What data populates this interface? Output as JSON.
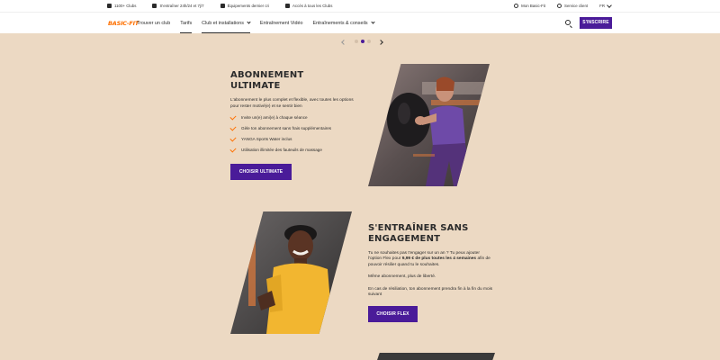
{
  "topbar": {
    "perks": [
      "1100+ Clubs",
      "S'entraîner 24h/24 et 7j/7",
      "Équipements dernier cri",
      "Accès à tous les Clubs"
    ],
    "my_account": "Mon Basic-Fit",
    "customer_service": "Service client",
    "language": "FR"
  },
  "nav": {
    "logo": "BASIC-FIT",
    "items": [
      {
        "label": "Trouver un club",
        "active": false,
        "dropdown": false
      },
      {
        "label": "Tarifs",
        "active": true,
        "dropdown": false
      },
      {
        "label": "Club et installations",
        "active": false,
        "dropdown": true
      },
      {
        "label": "Entraînement Vidéo",
        "active": false,
        "dropdown": false
      },
      {
        "label": "Entraînements & conseils",
        "active": false,
        "dropdown": true
      }
    ],
    "signup": "S'INSCRIRE"
  },
  "carousel": {
    "current": 2,
    "total": 3
  },
  "section_ultimate": {
    "title_line1": "ABONNEMENT",
    "title_line2": "ULTIMATE",
    "description": "L'abonnement le plus complet et flexible, avec toutes les options pour rester motivé(e) et se sentir bien",
    "features": [
      "Invite un(e) ami(e) à chaque séance",
      "Gèle ton abonnement sans frais supplémentaires",
      "YANGA Sports Water inclus",
      "Utilisation illimitée des fauteuils de massage"
    ],
    "button": "CHOISIR ULTIMATE"
  },
  "section_flex": {
    "title_line1": "S'ENTRAÎNER SANS",
    "title_line2": "ENGAGEMENT",
    "para1_a": "Tu ne souhaites pas t'engager sur un an ? Tu peux ajouter l'option Flex pour ",
    "para1_bold": "9,99 € de plus toutes les 4 semaines",
    "para1_b": " afin de pouvoir résilier quand tu le souhaites.",
    "para2": "Même abonnement, plus de liberté.",
    "para3": "En cas de résiliation, ton abonnement prendra fin à la fin du mois suivant",
    "button": "CHOISIR FLEX"
  },
  "colors": {
    "background": "#ecd9c3",
    "accent_purple": "#4a1b99",
    "brand_orange": "#fe7000"
  }
}
